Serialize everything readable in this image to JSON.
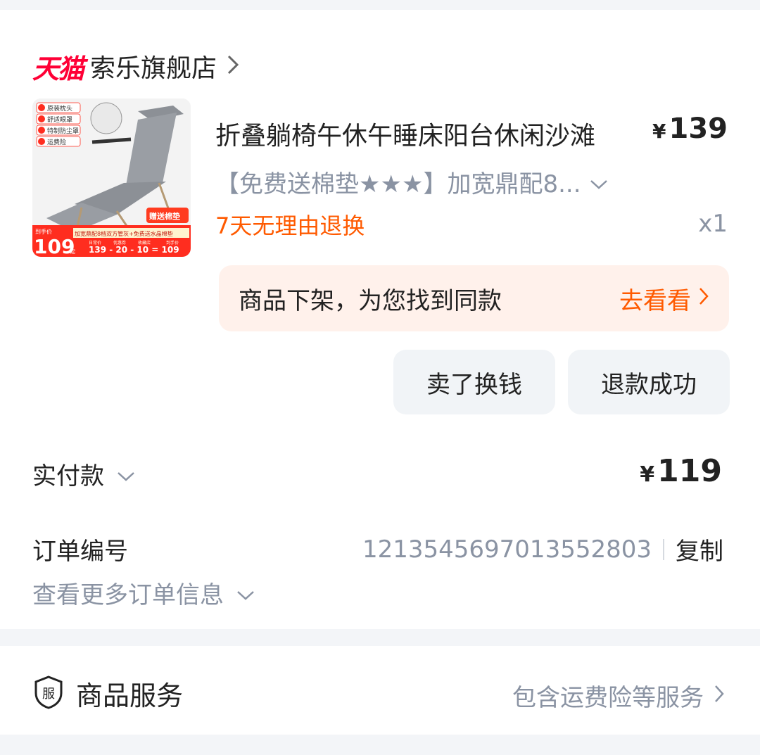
{
  "shop": {
    "platform_logo": "天猫",
    "name": "索乐旗舰店",
    "icon": "chevron-right-icon"
  },
  "product": {
    "title": "折叠躺椅午休午睡床阳台休闲沙滩",
    "price_symbol": "¥",
    "price": "139",
    "sku": "【免费送棉垫★★★】加宽鼎配8...",
    "return_policy": "7天无理由退换",
    "quantity": "x1",
    "thumbnail": {
      "features": [
        "原装枕头",
        "舒适眼罩",
        "特制防尘罩",
        "运费险"
      ],
      "gift_badge": "赠送棉垫",
      "handprice_label": "到手价",
      "handprice": "109",
      "handprice_unit": "起",
      "banner": "加宽鼎配8档双方管灰+免费送水晶棉垫",
      "formula_labels": [
        "日常价",
        "优惠券",
        "收藏店",
        "到手价"
      ],
      "formula": "139 - 20 - 10 = 109",
      "colors": {
        "accent": "#ff2d1f",
        "chair": "#8c9096"
      }
    }
  },
  "similar_notice": {
    "text": "商品下架，为您找到同款",
    "link": "去看看"
  },
  "actions": {
    "sell_label": "卖了换钱",
    "refund_label": "退款成功"
  },
  "payment": {
    "label": "实付款",
    "symbol": "¥",
    "amount": "119"
  },
  "order": {
    "label": "订单编号",
    "number": "1213545697013552803",
    "copy_label": "复制",
    "more_label": "查看更多订单信息"
  },
  "service": {
    "icon_char": "服",
    "title": "商品服务",
    "summary": "包含运费险等服务"
  },
  "colors": {
    "tmall_red": "#ff0036",
    "orange": "#ff5a00",
    "muted": "#8a93a3",
    "notice_bg": "#fff1eb",
    "button_bg": "#f1f4f7",
    "page_bg": "#f3f5f8"
  }
}
